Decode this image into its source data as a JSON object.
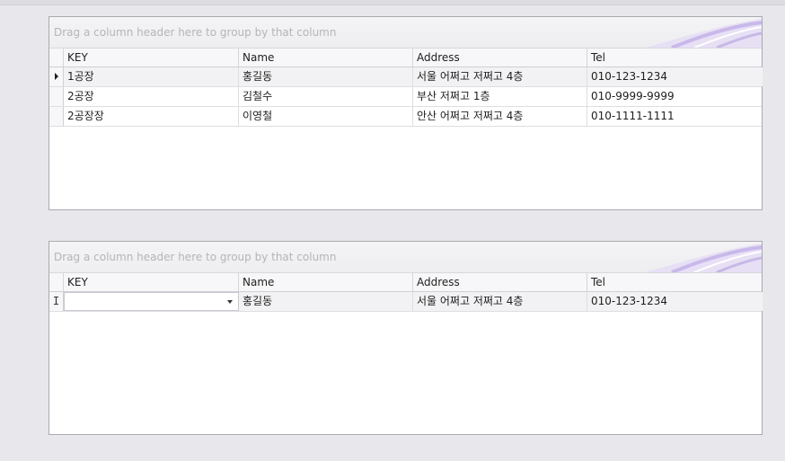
{
  "grids": [
    {
      "group_panel_text": "Drag a column header here to group by that column",
      "columns": [
        "KEY",
        "Name",
        "Address",
        "Tel"
      ],
      "rows": [
        {
          "key": "1공장",
          "name": "홍길동",
          "address": "서울 어쩌고 저쩌고 4층",
          "tel": "010-123-1234"
        },
        {
          "key": "2공장",
          "name": "김철수",
          "address": "부산 저쩌고 1층",
          "tel": "010-9999-9999"
        },
        {
          "key": "2공장장",
          "name": "이영철",
          "address": "안산 어쩌고 저쩌고 4층",
          "tel": "010-1111-1111"
        }
      ]
    },
    {
      "group_panel_text": "Drag a column header here to group by that column",
      "columns": [
        "KEY",
        "Name",
        "Address",
        "Tel"
      ],
      "rows": [
        {
          "key": "",
          "name": "홍길동",
          "address": "서울 어쩌고 저쩌고 4층",
          "tel": "010-123-1234"
        }
      ]
    }
  ],
  "icons": {
    "focused_row_indicator": "triangle-right-icon",
    "edit_row_indicator": "text-cursor-icon",
    "dropdown": "chevron-down-icon"
  },
  "colors": {
    "accent_swoosh": "#b9a6e0",
    "background": "#e8e8ec"
  }
}
